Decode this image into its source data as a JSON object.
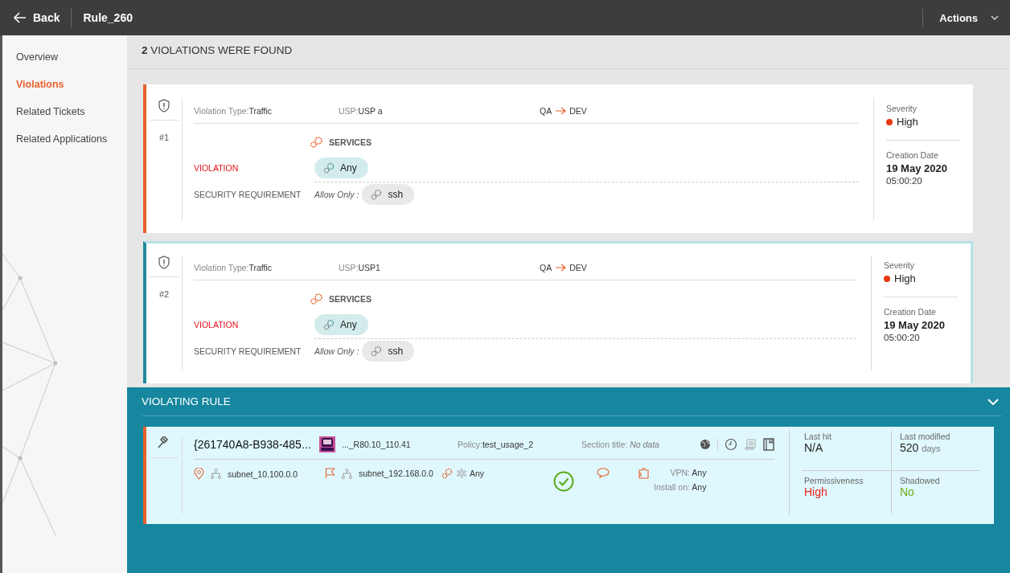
{
  "header": {
    "back": "Back",
    "title": "Rule_260",
    "actions": "Actions"
  },
  "sidebar": {
    "items": [
      {
        "label": "Overview",
        "selected": false
      },
      {
        "label": "Violations",
        "selected": true
      },
      {
        "label": "Related Tickets",
        "selected": false
      },
      {
        "label": "Related Applications",
        "selected": false
      }
    ]
  },
  "summary": "**2** VIOLATIONS WERE FOUND",
  "violations": [
    {
      "selected": true,
      "number": "#1",
      "type_label": "Violation Type:",
      "type": "Traffic",
      "usp_label": "USP:",
      "usp": "USP a",
      "from": "QA",
      "to": "DEV",
      "section": "SERVICES",
      "violation_label": "VIOLATION",
      "violation_value": "Any",
      "requirement_label": "SECURITY REQUIREMENT",
      "requirement_prefix": "Allow Only :",
      "requirement_value": "ssh",
      "severity_label": "Severity",
      "severity": "High",
      "color": "#e8380d",
      "date_label": "Creation Date",
      "date": "19 May 2020",
      "time": "05:00:20"
    },
    {
      "selected": false,
      "number": "#2",
      "type_label": "Violation Type:",
      "type": "Traffic",
      "usp_label": "USP:",
      "usp": "USP1",
      "from": "QA",
      "to": "DEV",
      "section": "SERVICES",
      "violation_label": "VIOLATION",
      "violation_value": "Any",
      "requirement_label": "SECURITY REQUIREMENT",
      "requirement_prefix": "Allow Only :",
      "requirement_value": "ssh",
      "severity_label": "Severity",
      "severity": "High",
      "color": "#e8380d",
      "date_label": "Creation Date",
      "date": "19 May 2020",
      "time": "05:00:20"
    }
  ],
  "rule": {
    "title": "VIOLATING RULE",
    "expanded": true,
    "name": "{261740A8-B938-485...",
    "device": "..._R80.10_110.41",
    "policy_label": "Policy:",
    "policy": "test_usage_2",
    "section_label": "Section title:",
    "section": "No data",
    "source": "subnet_10.100.0.0",
    "destination": "subnet_192.168.0.0",
    "service": "Any",
    "vpn_label": "VPN:",
    "vpn": "Any",
    "install_label": "Install on:",
    "install": "Any",
    "stats": [
      {
        "label": "Last hit",
        "value": "N/A",
        "color": "#222222"
      },
      {
        "label": "Last modified",
        "value": "520",
        "unit": "days",
        "color": "#222222"
      },
      {
        "label": "Permissiveness",
        "value": "High",
        "color": "#e8201a"
      },
      {
        "label": "Shadowed",
        "value": "No",
        "color": "#6aaa18"
      }
    ]
  }
}
